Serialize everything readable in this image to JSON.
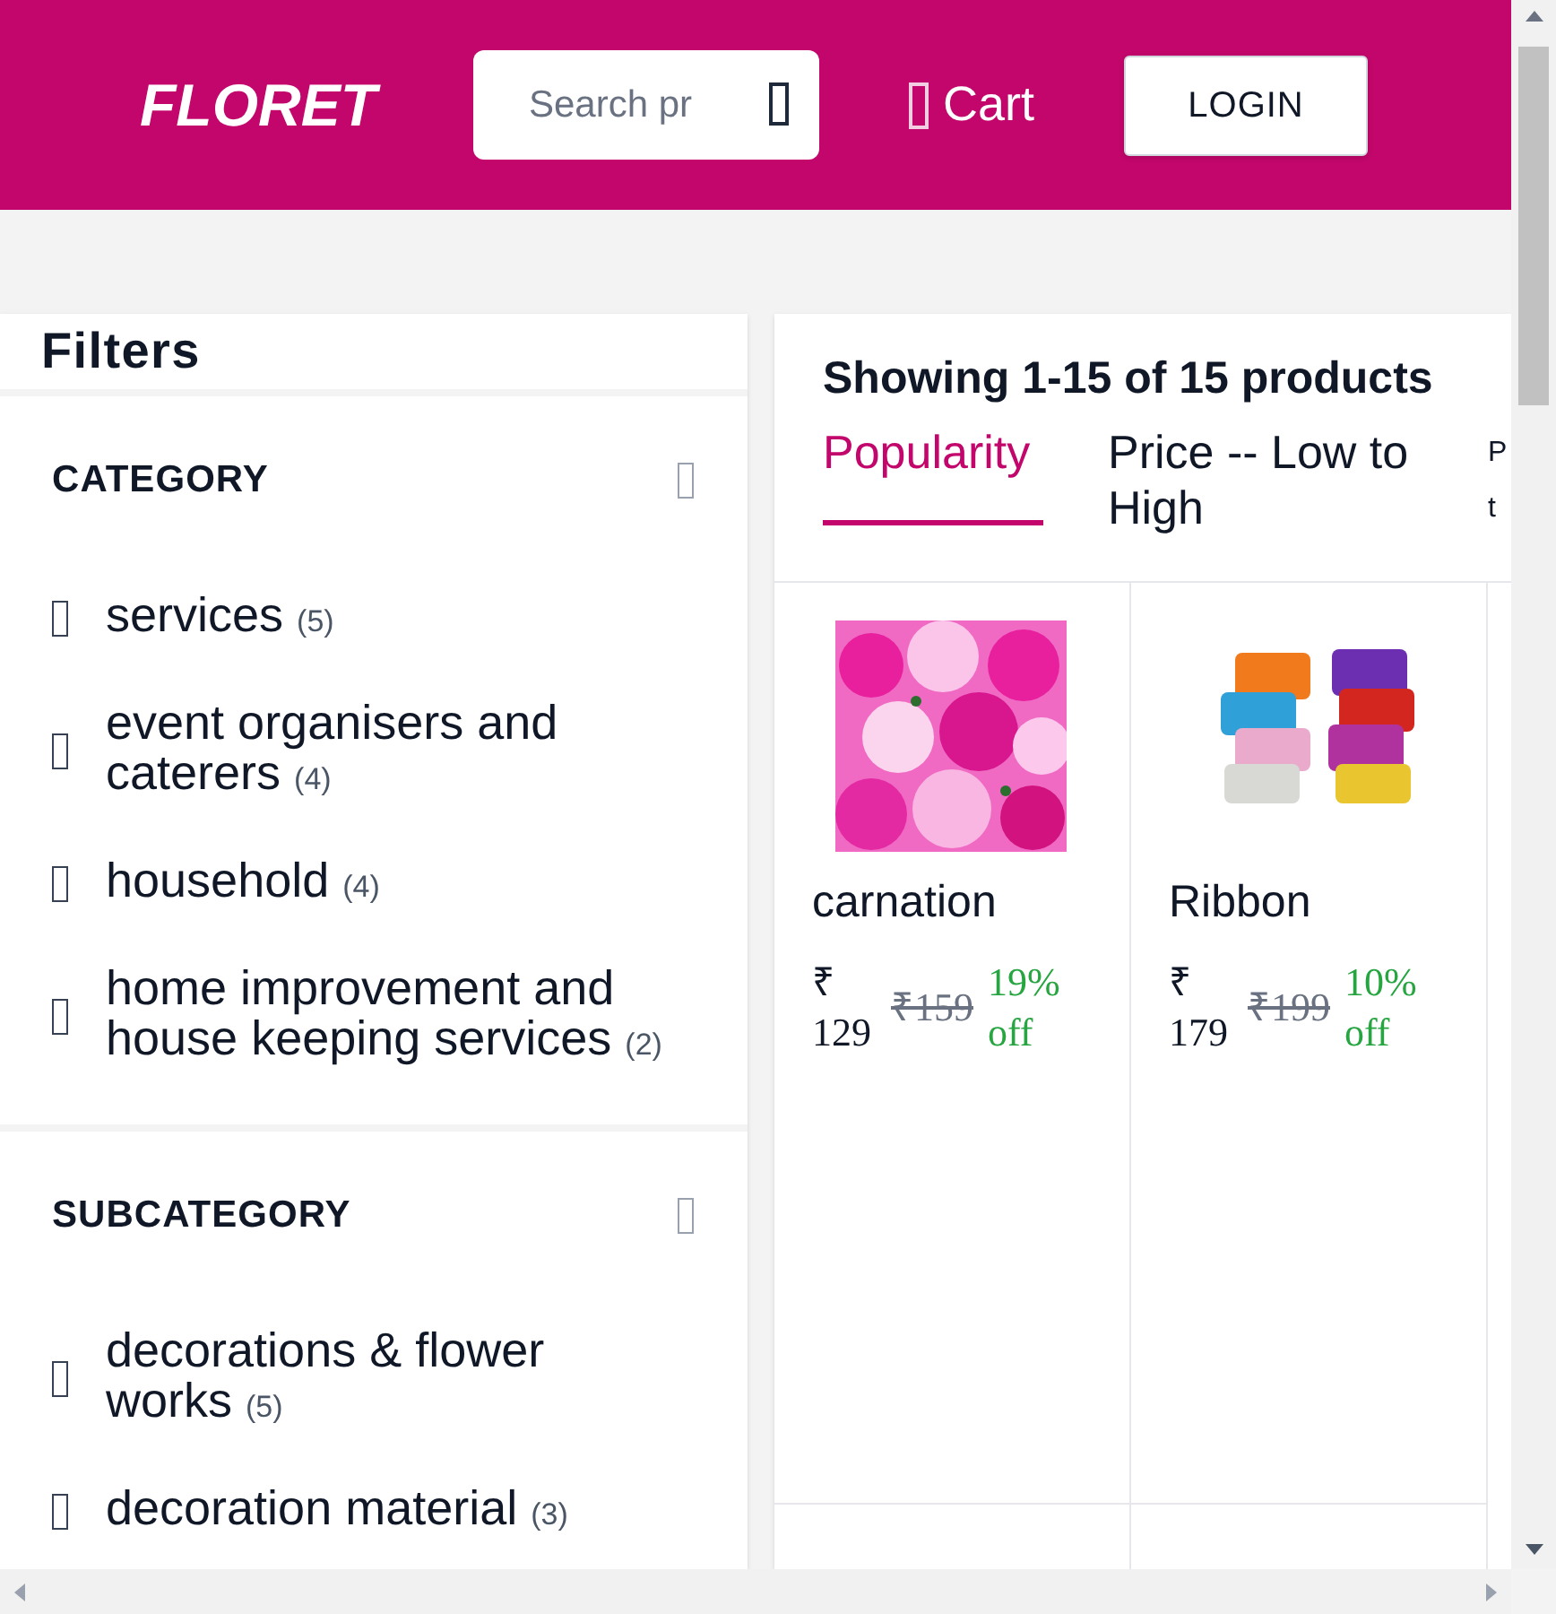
{
  "header": {
    "logo": "FLORET",
    "search": {
      "placeholder": "Search pr"
    },
    "cart": "Cart",
    "login": "LOGIN"
  },
  "filters": {
    "title": "Filters",
    "sections": [
      {
        "title": "CATEGORY",
        "items": [
          {
            "label": "services",
            "count": "(5)",
            "checked": false
          },
          {
            "label": "event organisers and caterers",
            "count": "(4)",
            "checked": false
          },
          {
            "label": "household",
            "count": "(4)",
            "checked": false
          },
          {
            "label": "home improvement and house keeping services",
            "count": "(2)",
            "checked": false
          }
        ]
      },
      {
        "title": "SUBCATEGORY",
        "items": [
          {
            "label": "decorations & flower works",
            "count": "(5)",
            "checked": false
          },
          {
            "label": "decoration material",
            "count": "(3)",
            "checked": false
          }
        ]
      }
    ]
  },
  "results": {
    "summary": "Showing 1-15 of 15 products",
    "sort_tabs": [
      {
        "label": "Popularity",
        "selected": true
      },
      {
        "label": "Price -- Low to High",
        "selected": false
      },
      {
        "label": "P t",
        "selected": false
      }
    ],
    "products": [
      {
        "name": "carnation",
        "price": "₹ 129",
        "mrp": "₹159",
        "discount": "19% off"
      },
      {
        "name": "Ribbon",
        "price": "₹ 179",
        "mrp": "₹199",
        "discount": "10% off"
      }
    ]
  }
}
